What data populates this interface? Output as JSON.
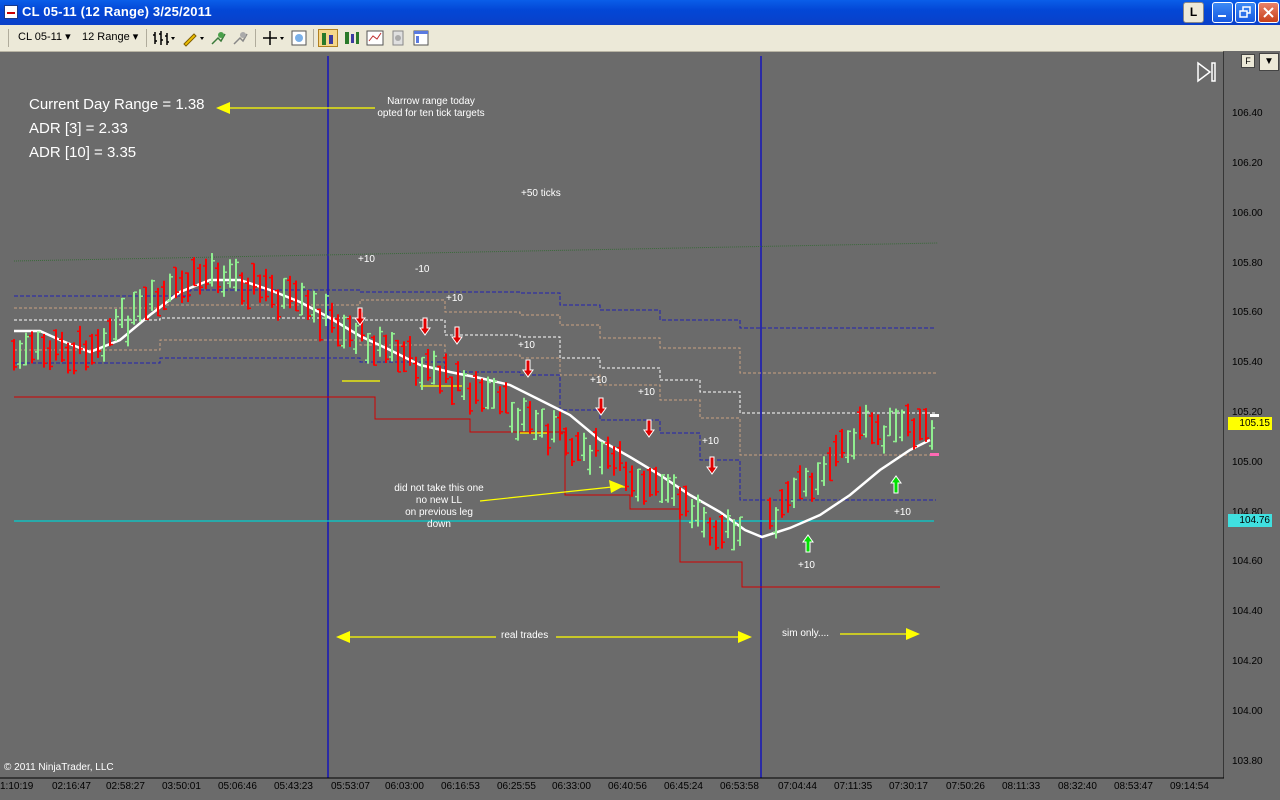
{
  "window": {
    "title": "CL 05-11 (12 Range)  3/25/2011",
    "btn_l": "L"
  },
  "toolbar": {
    "instrument": "CL 05-11",
    "interval": "12 Range"
  },
  "stats": {
    "current_day_range": "Current Day Range = 1.38",
    "adr3": "ADR [3] = 2.33",
    "adr10": "ADR [10] = 3.35"
  },
  "notes": {
    "narrow_line1": "Narrow range today",
    "narrow_line2": "opted for ten tick targets",
    "plus50": "+50 ticks",
    "didnot_line1": "did not take this one",
    "didnot_line2": "no new LL",
    "didnot_line3": "on previous leg",
    "didnot_line4": "down",
    "real_trades": "real trades",
    "sim_only": "sim only...."
  },
  "trade_labels": [
    "+10",
    "-10",
    "+10",
    "+10",
    "+10",
    "+10",
    "+10",
    "+10",
    "+10"
  ],
  "price_axis": [
    "106.40",
    "106.20",
    "106.00",
    "105.80",
    "105.60",
    "105.40",
    "105.20",
    "105.00",
    "104.80",
    "104.60",
    "104.40",
    "104.20",
    "104.00",
    "103.80"
  ],
  "price_badges": {
    "current": "105.15",
    "line": "104.76"
  },
  "time_axis": [
    "1:10:19",
    "02:16:47",
    "02:58:27",
    "03:50:01",
    "05:06:46",
    "05:43:23",
    "05:53:07",
    "06:03:00",
    "06:16:53",
    "06:25:55",
    "06:33:00",
    "06:40:56",
    "06:45:24",
    "06:53:58",
    "07:04:44",
    "07:11:35",
    "07:30:17",
    "07:50:26",
    "08:11:33",
    "08:32:40",
    "08:53:47",
    "09:14:54"
  ],
  "copyright": "© 2011 NinjaTrader, LLC",
  "colors": {
    "background": "#6b6b6b",
    "up_bar": "#90ee90",
    "down_bar": "#ff0000",
    "sma": "#ffffff",
    "session_line": "#0000cc",
    "cyan_line": "#00d0d0",
    "badge_current": "#ffff00",
    "badge_line": "#40e0e0"
  }
}
